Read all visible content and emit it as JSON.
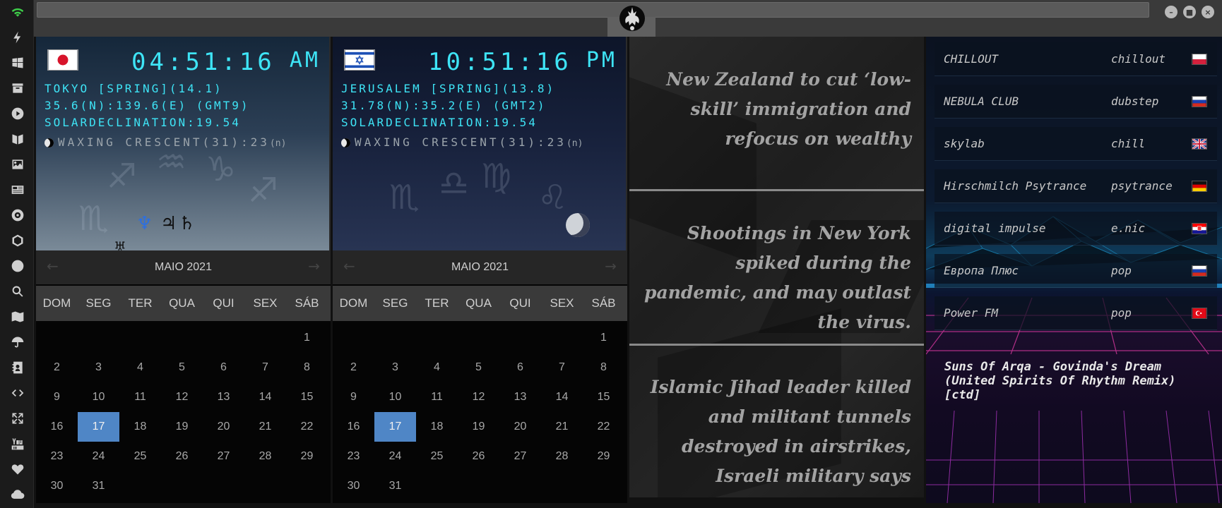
{
  "clocks": [
    {
      "flag": "japan",
      "time": "04:51:16",
      "ampm": "AM",
      "city_line": "TOKYO [SPRING](14.1)",
      "coords_line": "35.6(N):139.6(E) (GMT9)",
      "declination_line": "SOLARDECLINATION:19.54",
      "moon_line": "WAXING CRESCENT(31):23",
      "moon_suffix": "(n)"
    },
    {
      "flag": "israel",
      "time": "10:51:16",
      "ampm": "PM",
      "city_line": "JERUSALEM [SPRING](13.8)",
      "coords_line": "31.78(N):35.2(E) (GMT2)",
      "declination_line": "SOLARDECLINATION:19.54",
      "moon_line": "WAXING CRESCENT(31):23",
      "moon_suffix": "(n)"
    }
  ],
  "calendars": [
    {
      "month": "MAIO 2021",
      "days": [
        "DOM",
        "SEG",
        "TER",
        "QUA",
        "QUI",
        "SEX",
        "SÁB"
      ],
      "today": 17
    },
    {
      "month": "MAIO 2021",
      "days": [
        "DOM",
        "SEG",
        "TER",
        "QUA",
        "QUI",
        "SEX",
        "SÁB"
      ],
      "today": 17
    }
  ],
  "calendar_dates": [
    "1",
    "2",
    "3",
    "4",
    "5",
    "6",
    "7",
    "8",
    "9",
    "10",
    "11",
    "12",
    "13",
    "14",
    "15",
    "16",
    "17",
    "18",
    "19",
    "20",
    "21",
    "22",
    "23",
    "24",
    "25",
    "26",
    "27",
    "28",
    "29",
    "30",
    "31"
  ],
  "news": [
    "New Zealand to cut ‘low-skill’ immigration and refocus on wealthy",
    "Shootings in New York spiked during the pandemic, and may outlast the virus.",
    "Islamic Jihad leader killed and militant tunnels destroyed in airstrikes, Israeli military says"
  ],
  "radio": {
    "stations": [
      {
        "name": "CHILLOUT",
        "genre": "chillout",
        "flag": "poland"
      },
      {
        "name": "NEBULA CLUB",
        "genre": "dubstep",
        "flag": "russia"
      },
      {
        "name": "skylab",
        "genre": "chill",
        "flag": "uk"
      },
      {
        "name": "Hirschmilch Psytrance",
        "genre": "psytrance",
        "flag": "germany"
      },
      {
        "name": "digital impulse",
        "genre": "e.nic",
        "flag": "croatia"
      },
      {
        "name": "Европа Плюс",
        "genre": "pop",
        "flag": "russia"
      },
      {
        "name": "Power FM",
        "genre": "pop",
        "flag": "turkey"
      }
    ],
    "now_playing": "Suns Of Arqa - Govinda's Dream (United Spirits Of Rhythm Remix) [ctd]"
  },
  "sidebar_icons": [
    "wifi-icon",
    "lightning-icon",
    "windows-icon",
    "archive-icon",
    "play-icon",
    "translate-icon",
    "image-icon",
    "news-icon",
    "settings-icon",
    "hexagon-icon",
    "globe-icon",
    "search-icon",
    "map-icon",
    "umbrella-icon",
    "contacts-icon",
    "code-icon",
    "expand-icon",
    "youtube-icon",
    "heart-icon",
    "cloud-icon"
  ],
  "colors": {
    "clock_text": "#3ee4f6",
    "today_highlight": "#4f86c6",
    "wifi_green": "#3ecf4a"
  }
}
